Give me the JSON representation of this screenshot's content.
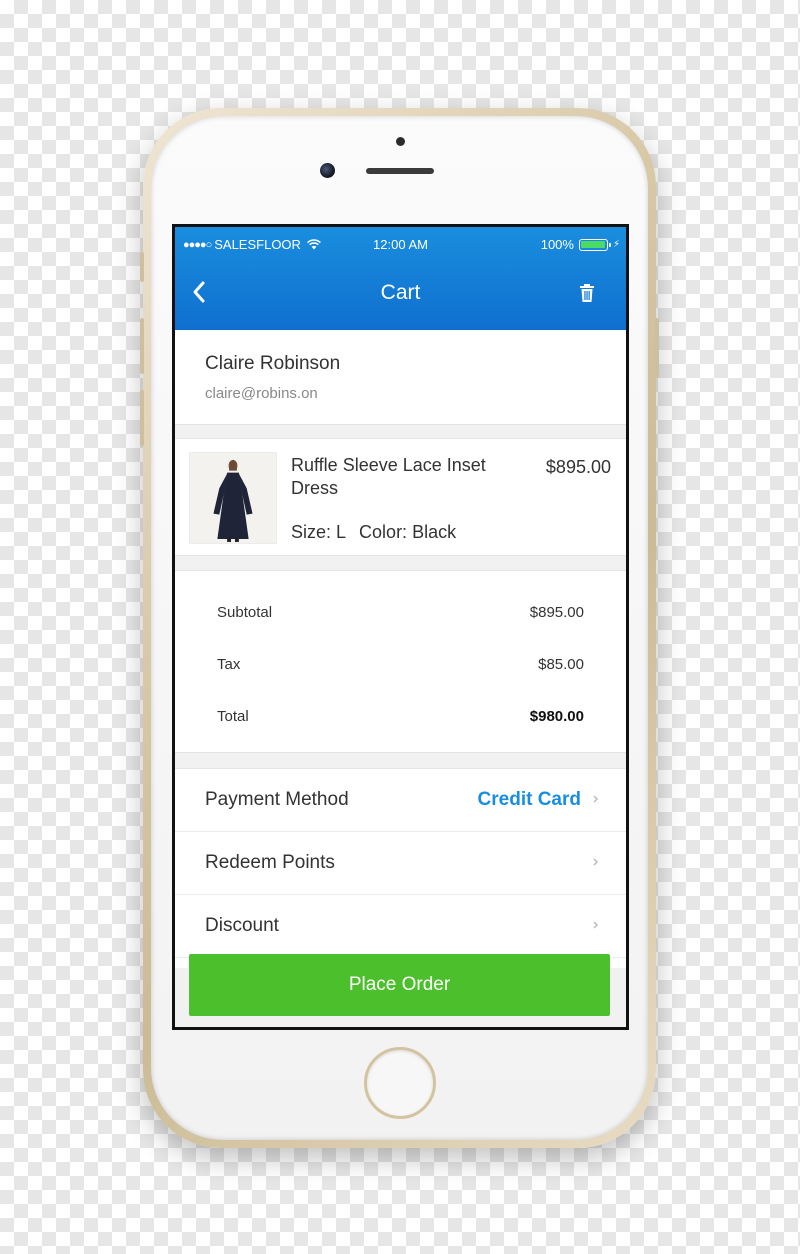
{
  "status_bar": {
    "signal": "●●●●○",
    "carrier": "SALESFLOOR",
    "time": "12:00 AM",
    "battery": "100%",
    "battery_level": 1.0,
    "battery_color": "#4cd964"
  },
  "nav": {
    "title": "Cart",
    "back_icon": "chevron-left-icon",
    "delete_icon": "trash-icon",
    "bar_color": "#1a8ede"
  },
  "customer": {
    "name": "Claire Robinson",
    "email": "claire@robins.on"
  },
  "cart_item": {
    "name": "Ruffle Sleeve Lace Inset Dress",
    "price": "$895.00",
    "size": "Size: L",
    "color": "Color: Black"
  },
  "totals": {
    "subtotal_label": "Subtotal",
    "subtotal_value": "$895.00",
    "tax_label": "Tax",
    "tax_value": "$85.00",
    "total_label": "Total",
    "total_value": "$980.00"
  },
  "options": [
    {
      "label": "Payment Method",
      "value": "Credit Card"
    },
    {
      "label": "Redeem Points",
      "value": ""
    },
    {
      "label": "Discount",
      "value": ""
    }
  ],
  "actions": {
    "place_order": "Place Order",
    "button_color": "#4cbf2c"
  }
}
